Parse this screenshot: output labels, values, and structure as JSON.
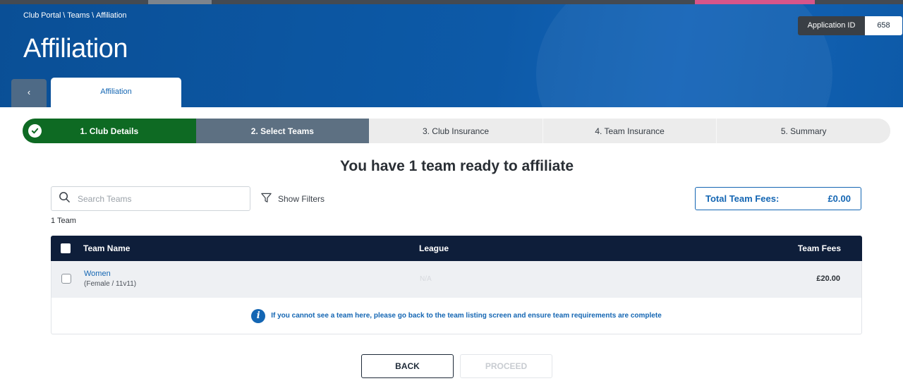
{
  "header": {
    "breadcrumb": [
      "Club Portal",
      "Teams",
      "Affiliation"
    ],
    "breadcrumb_separator": "\\",
    "title": "Affiliation",
    "application_id_label": "Application ID",
    "application_id_value": "658"
  },
  "tabs": {
    "back_glyph": "‹",
    "active_tab": "Affiliation"
  },
  "stepper": {
    "steps": [
      {
        "label": "1. Club Details",
        "state": "done"
      },
      {
        "label": "2. Select Teams",
        "state": "active"
      },
      {
        "label": "3. Club Insurance",
        "state": "todo"
      },
      {
        "label": "4. Team Insurance",
        "state": "todo"
      },
      {
        "label": "5. Summary",
        "state": "todo"
      }
    ]
  },
  "main": {
    "headline": "You have 1 team ready to affiliate",
    "search_placeholder": "Search Teams",
    "filters_label": "Show Filters",
    "fees_label": "Total Team Fees:",
    "fees_value": "£0.00",
    "team_count": "1 Team"
  },
  "table": {
    "columns": [
      "Team Name",
      "League",
      "Team Fees"
    ],
    "rows": [
      {
        "name": "Women",
        "details": "(Female / 11v11)",
        "league": "N/A",
        "fees": "£20.00"
      }
    ],
    "info_text": "If you cannot see a team here, please go back to the team listing screen and ensure team requirements are complete"
  },
  "actions": {
    "back_label": "BACK",
    "proceed_label": "PROCEED"
  },
  "colors": {
    "header_blue": "#0d5aa8",
    "step_done": "#0e6a23",
    "step_active": "#5d7082",
    "table_header": "#0e1e3a",
    "link_blue": "#1466b3"
  },
  "icons": {
    "search": "search-icon",
    "filter": "filter-icon",
    "check": "check-icon",
    "info": "info-icon",
    "back": "chevron-left-icon"
  }
}
